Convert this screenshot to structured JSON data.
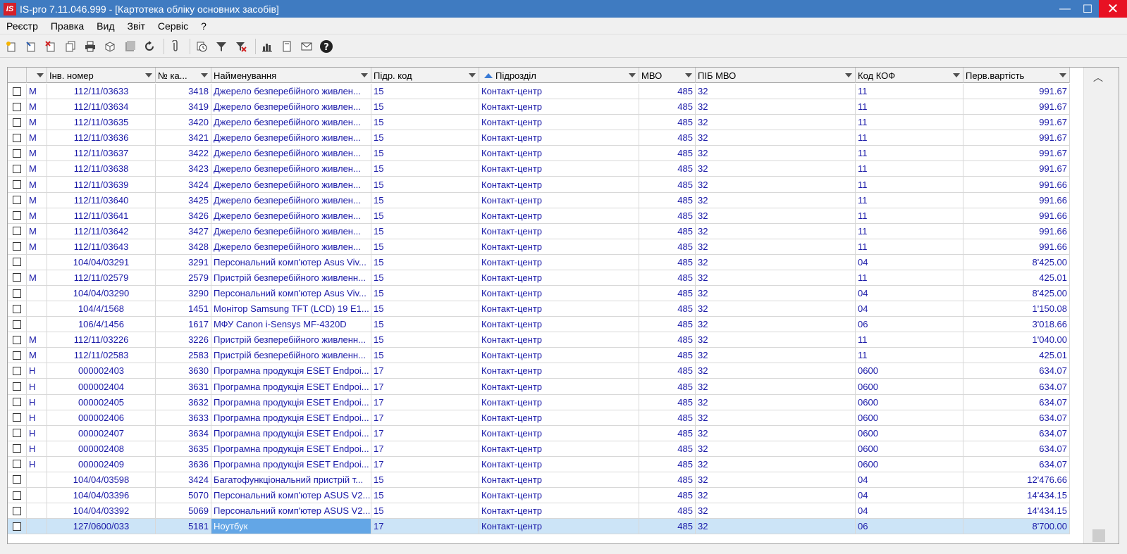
{
  "window": {
    "logo_text": "IS",
    "title": "IS-pro 7.11.046.999 - [Картотека обліку основних засобів]",
    "minimize": "—",
    "maximize": "☐",
    "close": "✕"
  },
  "menu": [
    "Реєстр",
    "Правка",
    "Вид",
    "Звіт",
    "Сервіс",
    "?"
  ],
  "toolbar_icons": [
    "new-icon",
    "new-copy-icon",
    "delete-icon",
    "copy-icon",
    "print-icon",
    "package-icon",
    "archive-icon",
    "refresh-icon",
    "attach-icon",
    "clock-icon",
    "filter-icon",
    "clear-filter-icon",
    "chart-icon",
    "document-icon",
    "mail-icon",
    "help-icon"
  ],
  "columns": {
    "inv": "Інв. номер",
    "no": "№ ка...",
    "name": "Найменування",
    "pcode": "Підр. код",
    "pname": "Підрозділ",
    "mvo": "МВО",
    "pib": "ПІБ МВО",
    "kof": "Код КОФ",
    "cost": "Перв.вартість"
  },
  "rows": [
    {
      "flag": "М",
      "inv": "112/11/03633",
      "no": "3418",
      "name": "Джерело безперебійного живлен...",
      "pcode": "15",
      "pname": "Контакт-центр",
      "mvo": "485",
      "pib": "32",
      "kof": "11",
      "cost": "991.67"
    },
    {
      "flag": "М",
      "inv": "112/11/03634",
      "no": "3419",
      "name": "Джерело безперебійного живлен...",
      "pcode": "15",
      "pname": "Контакт-центр",
      "mvo": "485",
      "pib": "32",
      "kof": "11",
      "cost": "991.67"
    },
    {
      "flag": "М",
      "inv": "112/11/03635",
      "no": "3420",
      "name": "Джерело безперебійного живлен...",
      "pcode": "15",
      "pname": "Контакт-центр",
      "mvo": "485",
      "pib": "32",
      "kof": "11",
      "cost": "991.67"
    },
    {
      "flag": "М",
      "inv": "112/11/03636",
      "no": "3421",
      "name": "Джерело безперебійного живлен...",
      "pcode": "15",
      "pname": "Контакт-центр",
      "mvo": "485",
      "pib": "32",
      "kof": "11",
      "cost": "991.67"
    },
    {
      "flag": "М",
      "inv": "112/11/03637",
      "no": "3422",
      "name": "Джерело безперебійного живлен...",
      "pcode": "15",
      "pname": "Контакт-центр",
      "mvo": "485",
      "pib": "32",
      "kof": "11",
      "cost": "991.67"
    },
    {
      "flag": "М",
      "inv": "112/11/03638",
      "no": "3423",
      "name": "Джерело безперебійного живлен...",
      "pcode": "15",
      "pname": "Контакт-центр",
      "mvo": "485",
      "pib": "32",
      "kof": "11",
      "cost": "991.67"
    },
    {
      "flag": "М",
      "inv": "112/11/03639",
      "no": "3424",
      "name": "Джерело безперебійного живлен...",
      "pcode": "15",
      "pname": "Контакт-центр",
      "mvo": "485",
      "pib": "32",
      "kof": "11",
      "cost": "991.66"
    },
    {
      "flag": "М",
      "inv": "112/11/03640",
      "no": "3425",
      "name": "Джерело безперебійного живлен...",
      "pcode": "15",
      "pname": "Контакт-центр",
      "mvo": "485",
      "pib": "32",
      "kof": "11",
      "cost": "991.66"
    },
    {
      "flag": "М",
      "inv": "112/11/03641",
      "no": "3426",
      "name": "Джерело безперебійного живлен...",
      "pcode": "15",
      "pname": "Контакт-центр",
      "mvo": "485",
      "pib": "32",
      "kof": "11",
      "cost": "991.66"
    },
    {
      "flag": "М",
      "inv": "112/11/03642",
      "no": "3427",
      "name": "Джерело безперебійного живлен...",
      "pcode": "15",
      "pname": "Контакт-центр",
      "mvo": "485",
      "pib": "32",
      "kof": "11",
      "cost": "991.66"
    },
    {
      "flag": "М",
      "inv": "112/11/03643",
      "no": "3428",
      "name": "Джерело безперебійного живлен...",
      "pcode": "15",
      "pname": "Контакт-центр",
      "mvo": "485",
      "pib": "32",
      "kof": "11",
      "cost": "991.66"
    },
    {
      "flag": "",
      "inv": "104/04/03291",
      "no": "3291",
      "name": "Персональний комп'ютер Asus Viv...",
      "pcode": "15",
      "pname": "Контакт-центр",
      "mvo": "485",
      "pib": "32",
      "kof": "04",
      "cost": "8'425.00"
    },
    {
      "flag": "М",
      "inv": "112/11/02579",
      "no": "2579",
      "name": "Пристрій безперебійного живленн...",
      "pcode": "15",
      "pname": "Контакт-центр",
      "mvo": "485",
      "pib": "32",
      "kof": "11",
      "cost": "425.01"
    },
    {
      "flag": "",
      "inv": "104/04/03290",
      "no": "3290",
      "name": "Персональний комп'ютер Asus Viv...",
      "pcode": "15",
      "pname": "Контакт-центр",
      "mvo": "485",
      "pib": "32",
      "kof": "04",
      "cost": "8'425.00"
    },
    {
      "flag": "",
      "inv": "104/4/1568",
      "no": "1451",
      "name": "Монітор Samsung TFT (LCD) 19 E1...",
      "pcode": "15",
      "pname": "Контакт-центр",
      "mvo": "485",
      "pib": "32",
      "kof": "04",
      "cost": "1'150.08"
    },
    {
      "flag": "",
      "inv": "106/4/1456",
      "no": "1617",
      "name": "МФУ Canon i-Sensys MF-4320D",
      "pcode": "15",
      "pname": "Контакт-центр",
      "mvo": "485",
      "pib": "32",
      "kof": "06",
      "cost": "3'018.66"
    },
    {
      "flag": "М",
      "inv": "112/11/03226",
      "no": "3226",
      "name": "Пристрій безперебійного живленн...",
      "pcode": "15",
      "pname": "Контакт-центр",
      "mvo": "485",
      "pib": "32",
      "kof": "11",
      "cost": "1'040.00"
    },
    {
      "flag": "М",
      "inv": "112/11/02583",
      "no": "2583",
      "name": "Пристрій безперебійного живленн...",
      "pcode": "15",
      "pname": "Контакт-центр",
      "mvo": "485",
      "pib": "32",
      "kof": "11",
      "cost": "425.01"
    },
    {
      "flag": "Н",
      "inv": "000002403",
      "no": "3630",
      "name": "Програмна продукція ESET Endpoi...",
      "pcode": "17",
      "pname": "Контакт-центр",
      "mvo": "485",
      "pib": "32",
      "kof": "0600",
      "cost": "634.07"
    },
    {
      "flag": "Н",
      "inv": "000002404",
      "no": "3631",
      "name": "Програмна продукція ESET Endpoi...",
      "pcode": "17",
      "pname": "Контакт-центр",
      "mvo": "485",
      "pib": "32",
      "kof": "0600",
      "cost": "634.07"
    },
    {
      "flag": "Н",
      "inv": "000002405",
      "no": "3632",
      "name": "Програмна продукція ESET Endpoi...",
      "pcode": "17",
      "pname": "Контакт-центр",
      "mvo": "485",
      "pib": "32",
      "kof": "0600",
      "cost": "634.07"
    },
    {
      "flag": "Н",
      "inv": "000002406",
      "no": "3633",
      "name": "Програмна продукція ESET Endpoi...",
      "pcode": "17",
      "pname": "Контакт-центр",
      "mvo": "485",
      "pib": "32",
      "kof": "0600",
      "cost": "634.07"
    },
    {
      "flag": "Н",
      "inv": "000002407",
      "no": "3634",
      "name": "Програмна продукція ESET Endpoi...",
      "pcode": "17",
      "pname": "Контакт-центр",
      "mvo": "485",
      "pib": "32",
      "kof": "0600",
      "cost": "634.07"
    },
    {
      "flag": "Н",
      "inv": "000002408",
      "no": "3635",
      "name": "Програмна продукція ESET Endpoi...",
      "pcode": "17",
      "pname": "Контакт-центр",
      "mvo": "485",
      "pib": "32",
      "kof": "0600",
      "cost": "634.07"
    },
    {
      "flag": "Н",
      "inv": "000002409",
      "no": "3636",
      "name": "Програмна продукція ESET Endpoi...",
      "pcode": "17",
      "pname": "Контакт-центр",
      "mvo": "485",
      "pib": "32",
      "kof": "0600",
      "cost": "634.07"
    },
    {
      "flag": "",
      "inv": "104/04/03598",
      "no": "3424",
      "name": "Багатофункціональний пристрій т...",
      "pcode": "15",
      "pname": "Контакт-центр",
      "mvo": "485",
      "pib": "32",
      "kof": "04",
      "cost": "12'476.66"
    },
    {
      "flag": "",
      "inv": "104/04/03396",
      "no": "5070",
      "name": "Персональний комп'ютер ASUS V2...",
      "pcode": "15",
      "pname": "Контакт-центр",
      "mvo": "485",
      "pib": "32",
      "kof": "04",
      "cost": "14'434.15"
    },
    {
      "flag": "",
      "inv": "104/04/03392",
      "no": "5069",
      "name": "Персональний комп'ютер ASUS V2...",
      "pcode": "15",
      "pname": "Контакт-центр",
      "mvo": "485",
      "pib": "32",
      "kof": "04",
      "cost": "14'434.15"
    },
    {
      "flag": "",
      "inv": "127/0600/033",
      "no": "5181",
      "name": "Ноутбук",
      "pcode": "17",
      "pname": "Контакт-центр",
      "mvo": "485",
      "pib": "32",
      "kof": "06",
      "cost": "8'700.00",
      "selected": true
    }
  ],
  "colors": {
    "titlebar": "#3f7bc1",
    "close_button": "#e81123",
    "cell_text": "#1a1aa8",
    "selected_row": "#cce4f7",
    "selected_cell": "#63a6e6"
  }
}
